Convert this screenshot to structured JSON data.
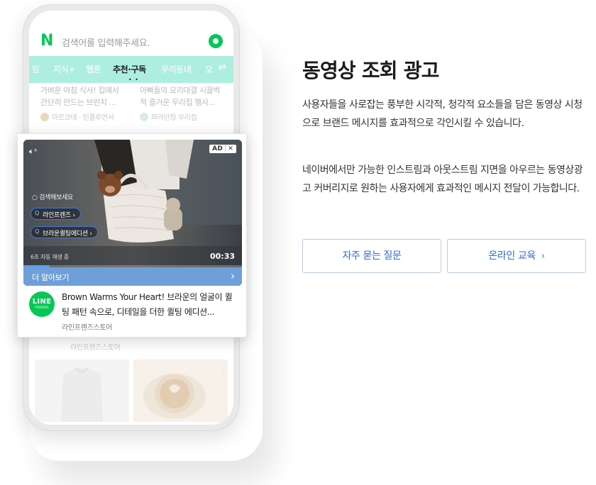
{
  "phone": {
    "search_placeholder": "검색어를 입력해주세요.",
    "logo_letter": "N",
    "tabs": [
      "임",
      "지식+",
      "웹툰",
      "추천·구독",
      "우리동네",
      "오"
    ],
    "active_tab": "추천·구독",
    "tab_dots": "• •",
    "tab_switch_icon": "⇌",
    "feed": [
      {
        "text": "가벼운 아침 식사! 집에서 간단히 만드는 브런치 ...",
        "source": "마르코테 · 인플루언서"
      },
      {
        "text": "아빠들의 요리대결 시끌벅적 즐거운 우리집 행사...",
        "source": "파라만장 우리집"
      }
    ],
    "below_source": "라인프렌즈스토어"
  },
  "ad": {
    "badge": "AD",
    "badge_close": "✕",
    "video_search": "검색해보세요",
    "pills": [
      "라인프렌즈 ›",
      "브라운퀼팅에디션 ›"
    ],
    "video_meta": "6초 자동 재생 중",
    "video_time": "00:33",
    "progress": 0.12,
    "more_label": "더 알아보기",
    "more_chevron": "›",
    "logo_line1": "LINE",
    "logo_line2": "FRIENDS",
    "title": "Brown Warms Your Heart! 브라운의 얼굴이 퀼팅 패턴 속으로, 디테일을 더한 퀼팅 에디션...",
    "brand": "라인프렌즈스토어"
  },
  "content": {
    "title": "동영상 조회 광고",
    "paragraph1": "사용자들을 사로잡는 풍부한 시각적, 청각적 요소들을 담은 동영상 시청으로 브랜드 메시지를 효과적으로 각인시킬 수 있습니다.",
    "paragraph2": "네이버에서만 가능한 인스트림과 아웃스트림 지면을 아우르는 동영상광고 커버리지로 원하는 사용자에게 효과적인 메시지 전달이 가능합니다.",
    "faq_button": "자주 묻는 질문",
    "edu_button": "온라인 교육",
    "edu_chevron": "›"
  },
  "colors": {
    "naver_green": "#03c75a",
    "tab_bar": "#aeeee0",
    "more_bar": "#6f9fd8",
    "button_text": "#2f6bd0",
    "line_green": "#06c755"
  }
}
